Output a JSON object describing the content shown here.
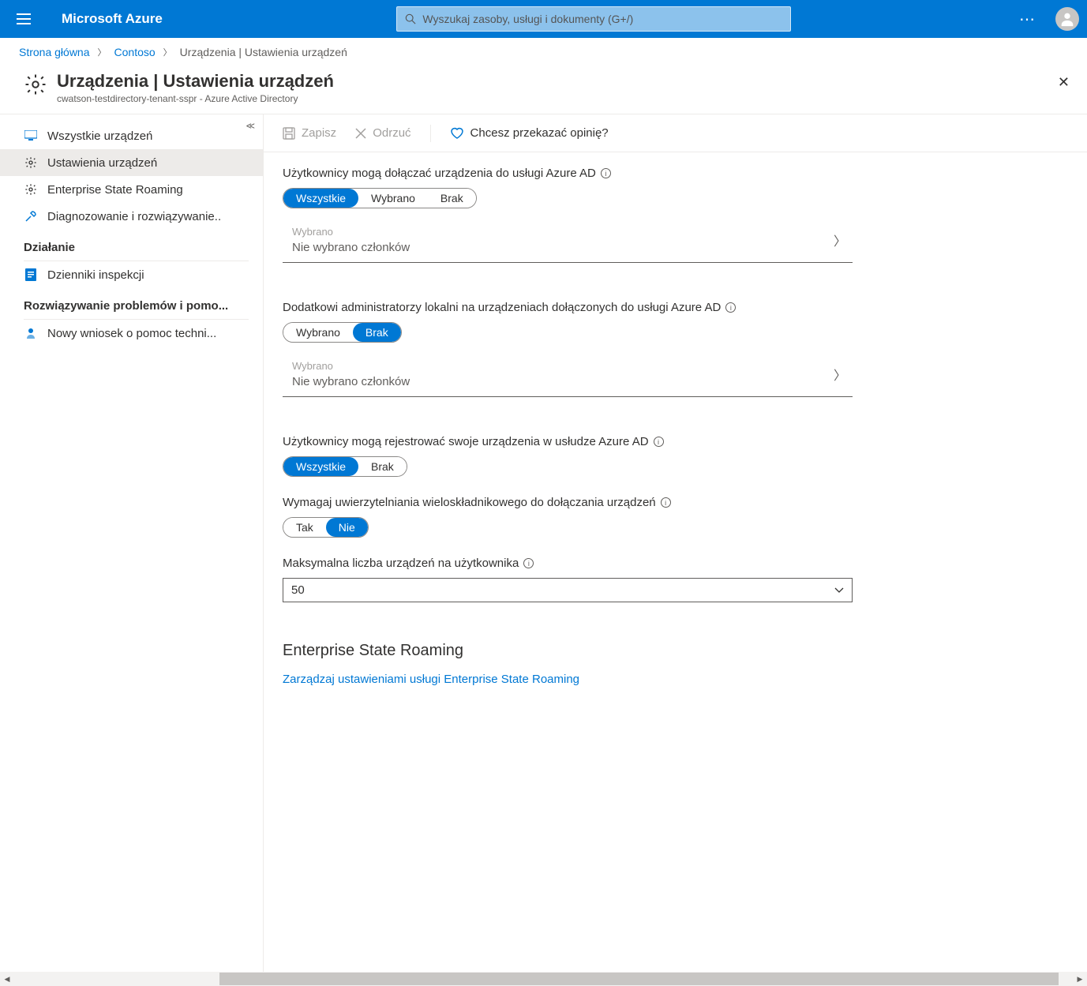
{
  "header": {
    "brand": "Microsoft Azure",
    "search_placeholder": "Wyszukaj zasoby, usługi i dokumenty (G+/)"
  },
  "breadcrumb": {
    "home": "Strona główna",
    "tenant": "Contoso",
    "current": "Urządzenia | Ustawienia urządzeń"
  },
  "page": {
    "title": "Urządzenia | Ustawienia urządzeń",
    "subtitle": "cwatson-testdirectory-tenant-sspr - Azure Active Directory"
  },
  "sidebar": {
    "items": [
      "Wszystkie urządzeń",
      "Ustawienia urządzeń",
      "Enterprise State Roaming",
      "Diagnozowanie i rozwiązywanie.."
    ],
    "section1": "Działanie",
    "audit": "Dzienniki inspekcji",
    "section2": "Rozwiązywanie problemów i pomo...",
    "support": "Nowy wniosek o pomoc techni..."
  },
  "toolbar": {
    "save": "Zapisz",
    "discard": "Odrzuć",
    "feedback": "Chcesz przekazać opinię?"
  },
  "settings": {
    "s1_label": "Użytkownicy mogą dołączać urządzenia do usługi Azure AD",
    "s1_opts": [
      "Wszystkie",
      "Wybrano",
      "Brak"
    ],
    "sel_label": "Wybrano",
    "sel_value": "Nie wybrano członków",
    "s2_label": "Dodatkowi administratorzy lokalni na urządzeniach dołączonych do usługi Azure AD",
    "s2_opts": [
      "Wybrano",
      "Brak"
    ],
    "s3_label": "Użytkownicy mogą rejestrować swoje urządzenia w usłudze Azure AD",
    "s3_opts": [
      "Wszystkie",
      "Brak"
    ],
    "s4_label": "Wymagaj uwierzytelniania wieloskładnikowego do dołączania urządzeń",
    "s4_opts": [
      "Tak",
      "Nie"
    ],
    "s5_label": "Maksymalna liczba urządzeń na użytkownika",
    "s5_value": "50",
    "esr_title": "Enterprise State Roaming",
    "esr_link": "Zarządzaj ustawieniami usługi Enterprise State Roaming"
  }
}
